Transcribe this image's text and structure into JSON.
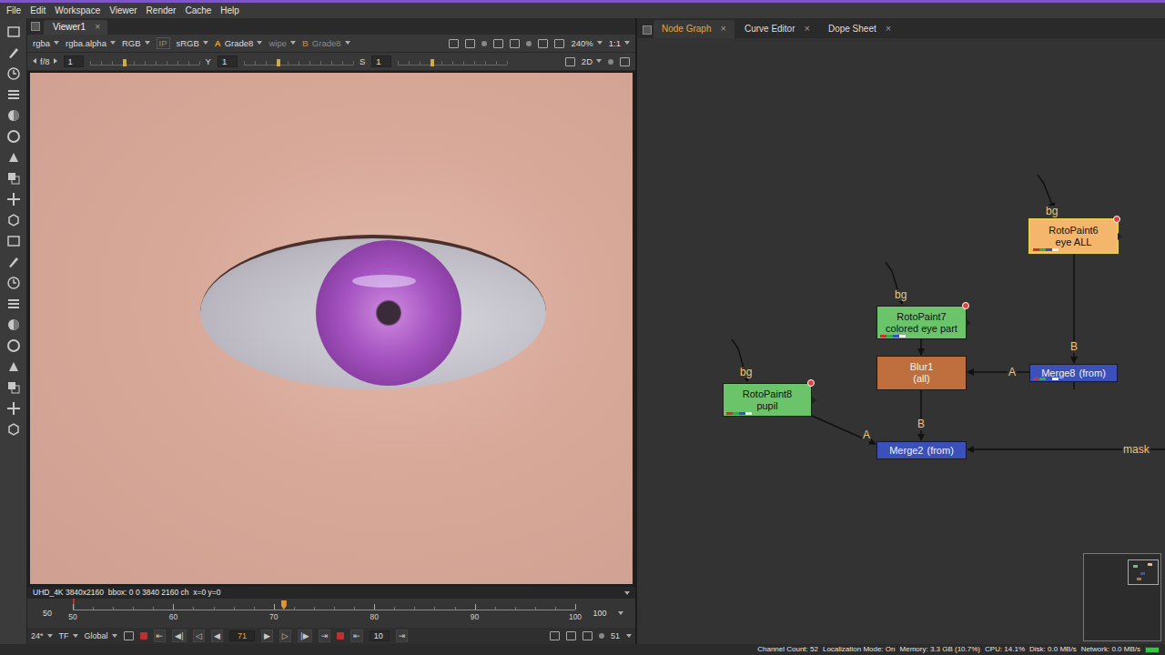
{
  "menu": [
    "File",
    "Edit",
    "Workspace",
    "Viewer",
    "Render",
    "Cache",
    "Help"
  ],
  "viewer": {
    "tab": {
      "label": "Viewer1",
      "close": "×",
      "selected": true
    },
    "controls": [
      {
        "text": "rgba",
        "kind": "dropdown",
        "disabled": false
      },
      {
        "text": "rgba.alpha",
        "kind": "dropdown",
        "disabled": false
      },
      {
        "text": "RGB",
        "kind": "dropdown",
        "disabled": false
      },
      {
        "text": "IP",
        "kind": "toggle",
        "disabled": true
      },
      {
        "text": "sRGB",
        "kind": "dropdown",
        "disabled": false
      },
      {
        "text": "A",
        "kind": "badge",
        "disabled": false
      },
      {
        "text": "Grade8",
        "kind": "dropdown",
        "disabled": false
      },
      {
        "text": "wipe",
        "kind": "dropdown",
        "disabled": true
      },
      {
        "text": "B",
        "kind": "badge",
        "disabled": true
      },
      {
        "text": "Grade8",
        "kind": "dropdown",
        "disabled": true
      },
      {
        "text": "240%",
        "kind": "zoom",
        "disabled": false
      },
      {
        "text": "1:1",
        "kind": "dropdown",
        "disabled": false
      }
    ],
    "controls2": [
      {
        "text": "f/8",
        "kind": "stepper"
      },
      {
        "text": "1",
        "kind": "field"
      },
      {
        "text": "Y",
        "kind": "label"
      },
      {
        "text": "1",
        "kind": "field"
      },
      {
        "text": "S",
        "kind": "label"
      },
      {
        "text": "1",
        "kind": "field"
      },
      {
        "text": "2D",
        "kind": "dropdown"
      }
    ],
    "info": "UHD_4K 3840x2160  bbox: 0 0 3840 2160 ch  x=0 y=0"
  },
  "timeline": {
    "in": "50",
    "out": "100",
    "ticks": [
      "50",
      "60",
      "70",
      "80",
      "90",
      "100"
    ],
    "level": 0.42
  },
  "playback": {
    "fps": "24*",
    "tf": "TF",
    "scope": "Global",
    "buttons_left": [
      "⇤",
      "◀|",
      "◁",
      "◀"
    ],
    "frame": "71",
    "buttons_right": [
      "▶",
      "▷",
      "|▶",
      "⇥"
    ],
    "step_back": "⇤",
    "increment": "10",
    "step_forward": "⇥",
    "end": "51"
  },
  "node_graph": {
    "tabs": [
      {
        "label": "Node Graph",
        "close": "×",
        "selected": true
      },
      {
        "label": "Curve Editor",
        "close": "×",
        "selected": false
      },
      {
        "label": "Dope Sheet",
        "close": "×",
        "selected": false
      }
    ],
    "nodes": [
      {
        "name": "RotoPaint6",
        "label": "eye ALL",
        "kind": "roto",
        "color": "#f3b66c",
        "selected": true
      },
      {
        "name": "RotoPaint7",
        "label": "colored eye part",
        "kind": "roto",
        "color": "#6cc46a",
        "selected": false
      },
      {
        "name": "Blur1",
        "label": "(all)",
        "kind": "blur",
        "color": "#bf6f3d",
        "selected": false
      },
      {
        "name": "Merge8",
        "label": "(from)",
        "kind": "merge",
        "color": "#3b50b8",
        "selected": false
      },
      {
        "name": "RotoPaint8",
        "label": "pupil",
        "kind": "roto",
        "color": "#6cc46a",
        "selected": false
      },
      {
        "name": "Merge2",
        "label": "(from)",
        "kind": "merge",
        "color": "#3b50b8",
        "selected": false
      }
    ],
    "edge_labels": [
      "bg",
      "B",
      "A",
      "bg",
      "B",
      "bg",
      "A",
      "mask"
    ]
  },
  "status_bar": [
    "Channel Count: 52",
    "Localization Mode: On",
    "Memory: 3.3 GB (10.7%)",
    "CPU: 14.1%",
    "Disk: 0.0 MB/s",
    "Network: 0.0 MB/s"
  ]
}
